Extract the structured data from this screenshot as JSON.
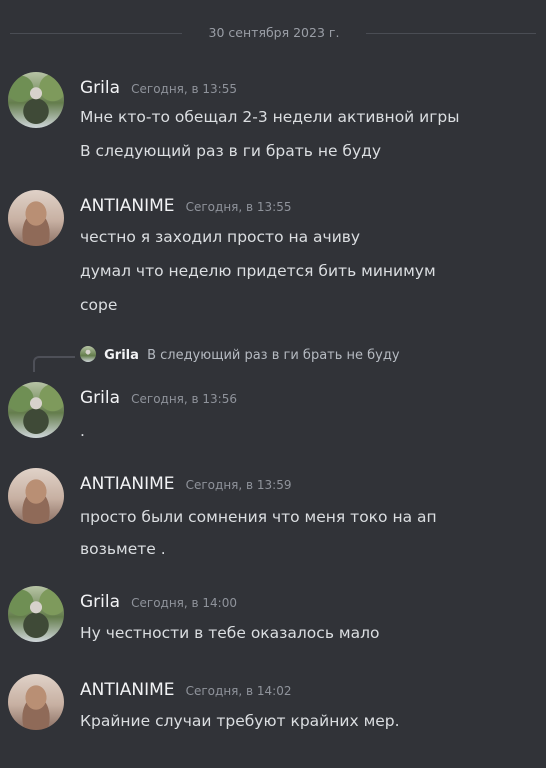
{
  "divider": {
    "date": "30 сентября 2023 г."
  },
  "messages": [
    {
      "username": "Grila",
      "timestamp": "Сегодня, в 13:55",
      "lines": [
        "Мне кто-то обещал 2-3 недели активной игры",
        "В следующий раз в ги брать не буду"
      ]
    },
    {
      "username": "ANTIANIME",
      "timestamp": "Сегодня, в 13:55",
      "lines": [
        "честно я заходил просто на ачиву",
        "думал что неделю придется бить минимум",
        "соре"
      ]
    },
    {
      "username": "Grila",
      "timestamp": "Сегодня, в 13:56",
      "reply": {
        "username": "Grila",
        "text": "В следующий раз в ги брать не буду"
      },
      "lines": [
        "."
      ]
    },
    {
      "username": "ANTIANIME",
      "timestamp": "Сегодня, в 13:59",
      "lines": [
        "просто были сомнения что меня токо на ап",
        "возьмете ."
      ]
    },
    {
      "username": "Grila",
      "timestamp": "Сегодня, в 14:00",
      "lines": [
        "Ну честности в тебе оказалось мало"
      ]
    },
    {
      "username": "ANTIANIME",
      "timestamp": "Сегодня, в 14:02",
      "lines": [
        "Крайние случаи требуют крайних мер."
      ]
    }
  ]
}
